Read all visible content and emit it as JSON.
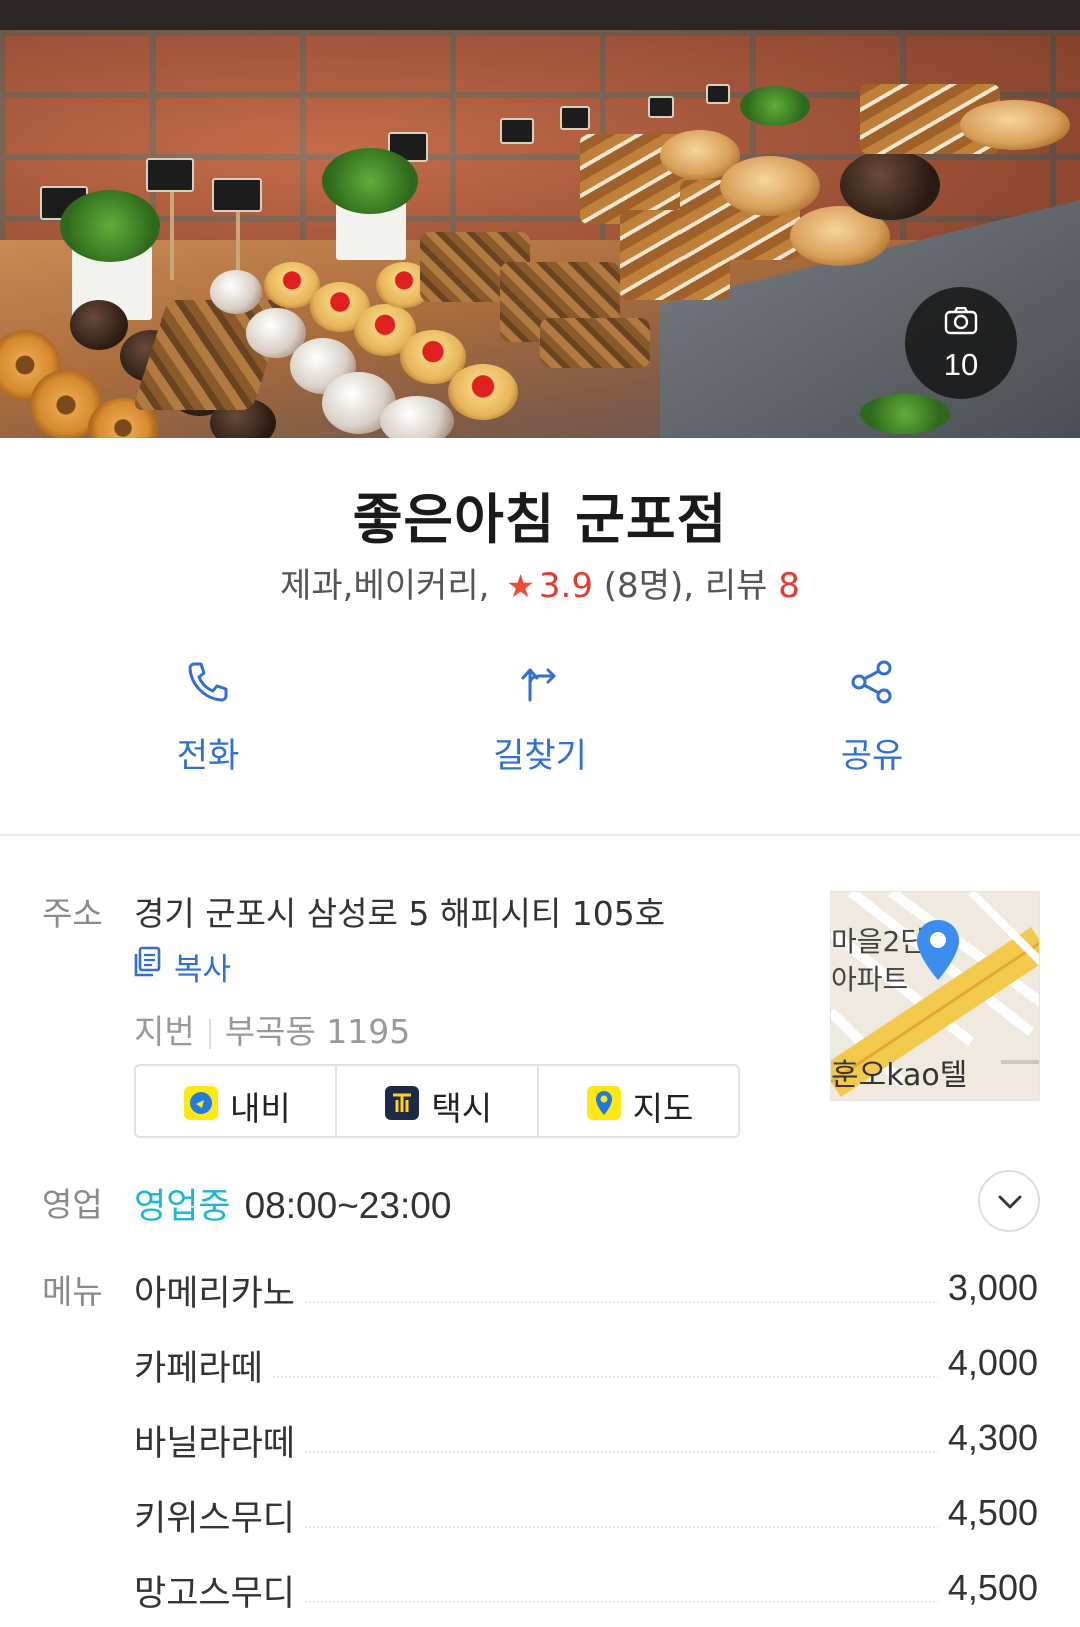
{
  "hero": {
    "photo_count": "10"
  },
  "place": {
    "name": "좋은아침 군포점",
    "category": "제과,베이커리,",
    "rating": "3.9",
    "rating_count": "(8명), 리뷰",
    "review_count": "8"
  },
  "actions": [
    {
      "label": "전화",
      "icon": "phone-icon"
    },
    {
      "label": "길찾기",
      "icon": "directions-icon"
    },
    {
      "label": "공유",
      "icon": "share-icon"
    }
  ],
  "address": {
    "label": "주소",
    "road": "경기 군포시 삼성로 5 해피시티 105호",
    "copy_label": "복사",
    "lot_label": "지번",
    "lot": "부곡동 1195",
    "map_text": [
      "마을2단",
      "아파트",
      "훈오kao텔"
    ]
  },
  "nav_buttons": [
    {
      "label": "내비",
      "icon": "navi-icon",
      "color": "#FFE812"
    },
    {
      "label": "택시",
      "icon": "taxi-icon",
      "color": "#1E2A4A"
    },
    {
      "label": "지도",
      "icon": "map-pin-icon",
      "color": "#FFE812"
    }
  ],
  "hours": {
    "label": "영업",
    "status": "영업중",
    "time": "08:00~23:00"
  },
  "menu": {
    "label": "메뉴",
    "items": [
      {
        "name": "아메리카노",
        "price": "3,000"
      },
      {
        "name": "카페라떼",
        "price": "4,000"
      },
      {
        "name": "바닐라라떼",
        "price": "4,300"
      },
      {
        "name": "키위스무디",
        "price": "4,500"
      },
      {
        "name": "망고스무디",
        "price": "4,500"
      }
    ]
  },
  "colors": {
    "accent_blue": "#2F6FD6",
    "rating_red": "#E8382B",
    "open_cyan": "#19B8D6"
  }
}
